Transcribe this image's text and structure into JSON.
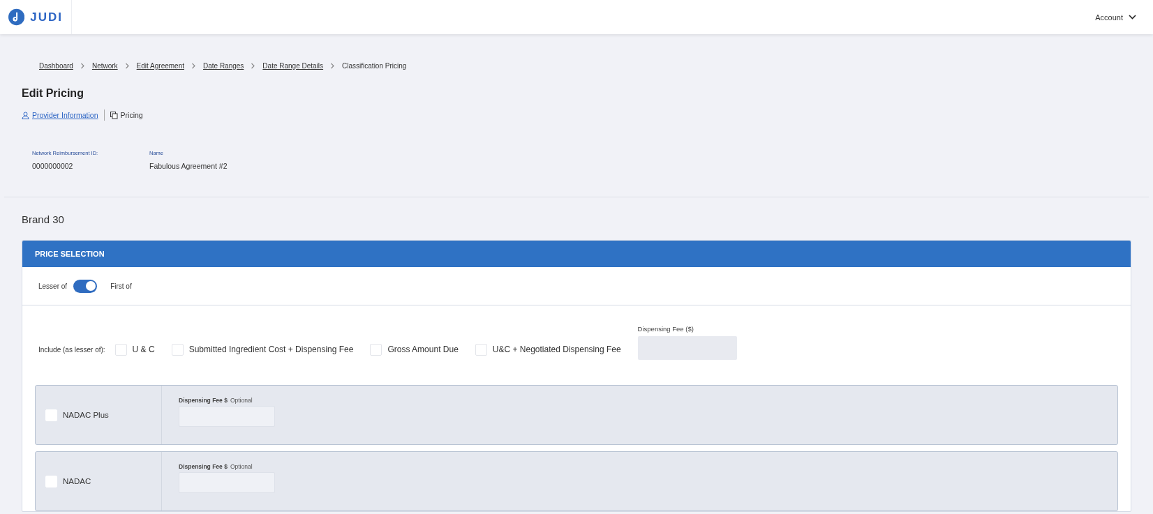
{
  "header": {
    "logo_text": "JUDI",
    "account_menu": "Account"
  },
  "breadcrumb": [
    {
      "label": "Dashboard",
      "link": true
    },
    {
      "label": "Network",
      "link": true
    },
    {
      "label": "Edit Agreement",
      "link": true
    },
    {
      "label": "Date Ranges",
      "link": true
    },
    {
      "label": "Date Range Details",
      "link": true
    },
    {
      "label": "Classification Pricing",
      "link": false
    }
  ],
  "page_title": "Edit Pricing",
  "tabs": [
    {
      "label": "Provider Information",
      "selected": false,
      "kind": "person"
    },
    {
      "label": "Pricing",
      "selected": true,
      "kind": "copy"
    }
  ],
  "summary": [
    {
      "label": "Network Reimbursement ID:",
      "value": "0000000002"
    },
    {
      "label": "Name",
      "value": "Fabulous Agreement #2"
    }
  ],
  "section_title": "Brand 30",
  "price_selection": {
    "title": "PRICE SELECTION",
    "toggle": {
      "left_label": "Lesser of",
      "right_label": "First of",
      "on": true
    },
    "include_label": "Include (as lesser of):",
    "options": [
      {
        "label": "U & C",
        "checked": false
      },
      {
        "label": "Submitted Ingredient Cost + Dispensing Fee",
        "checked": false
      },
      {
        "label": "Gross Amount Due",
        "checked": false
      },
      {
        "label": "U&C + Negotiated Dispensing Fee",
        "checked": false
      }
    ],
    "dispensing_fee": {
      "label": "Dispensing Fee ($)"
    },
    "rows": [
      {
        "label": "NADAC Plus",
        "checked": false,
        "fee_label": "Dispensing Fee $",
        "fee_hint": "Optional"
      },
      {
        "label": "NADAC",
        "checked": false,
        "fee_label": "Dispensing Fee $",
        "fee_hint": "Optional"
      }
    ]
  }
}
